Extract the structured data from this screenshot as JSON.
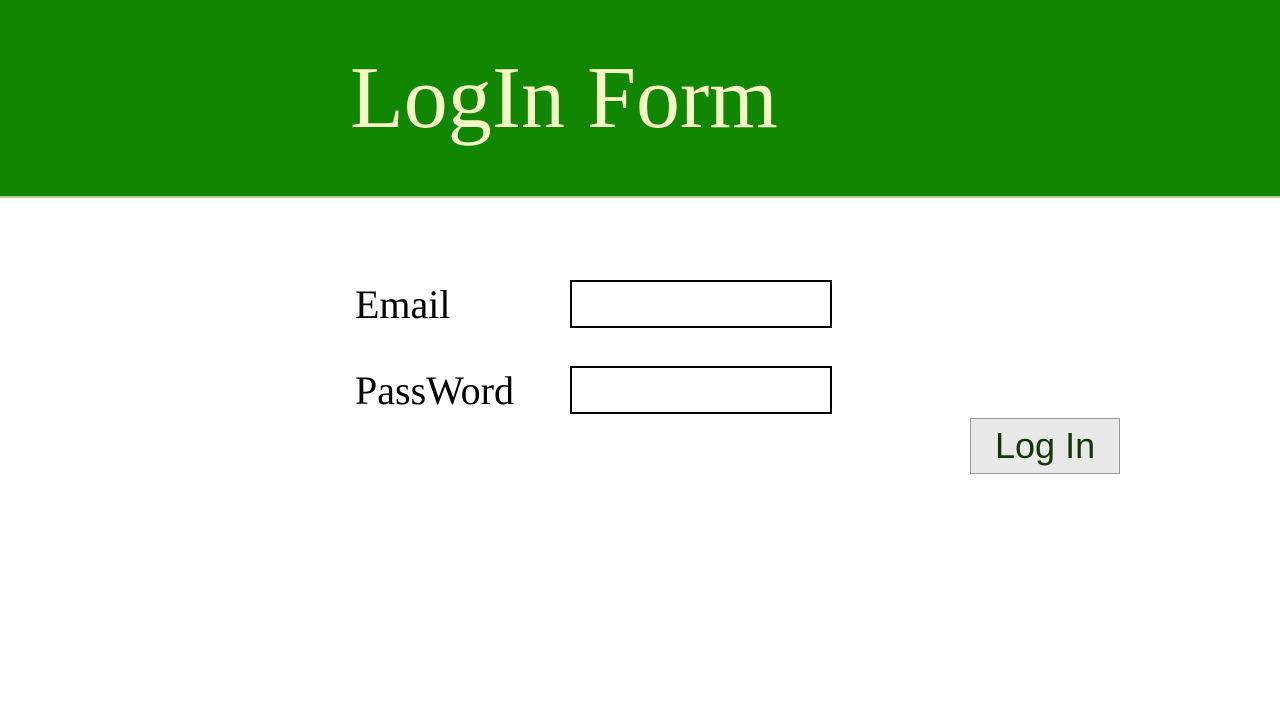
{
  "header": {
    "title": "LogIn Form"
  },
  "form": {
    "email_label": "Email",
    "email_value": "",
    "password_label": "PassWord",
    "password_value": "",
    "submit_label": "Log In"
  },
  "colors": {
    "header_bg": "#118600",
    "header_text": "#f4f7c6"
  }
}
